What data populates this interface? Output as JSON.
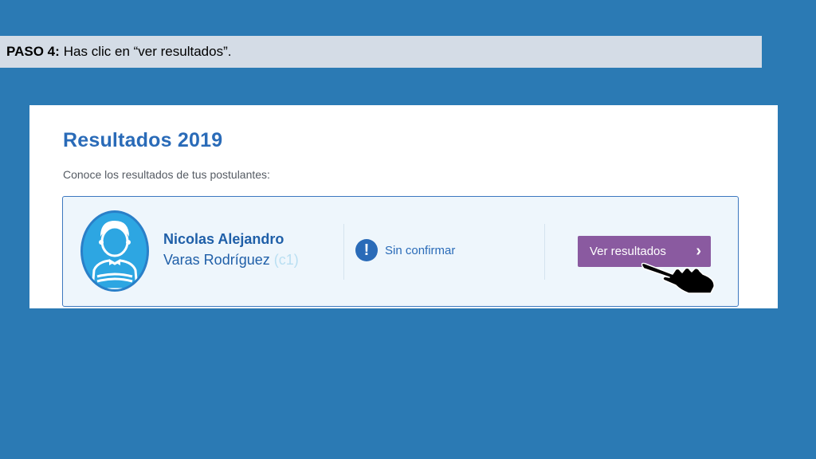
{
  "instruction": {
    "step_label": "PASO 4:",
    "text": "Has clic en “ver resultados”."
  },
  "screen": {
    "title": "Resultados 2019",
    "subtitle": "Conoce los resultados de tus postulantes:",
    "applicant": {
      "first_name": "Nicolas Alejandro",
      "last_name": "Varas Rodríguez",
      "code": "(c1)",
      "avatar_icon": "child-avatar-icon"
    },
    "status": {
      "icon": "exclamation-icon",
      "label": "Sin confirmar"
    },
    "button": {
      "label": "Ver resultados",
      "icon": "chevron-right-icon"
    },
    "cursor": "hand-pointer-icon",
    "colors": {
      "background": "#2b7ab4",
      "title": "#2a6bb8",
      "button": "#8a5aa0",
      "card_border": "#3d78bf"
    }
  }
}
